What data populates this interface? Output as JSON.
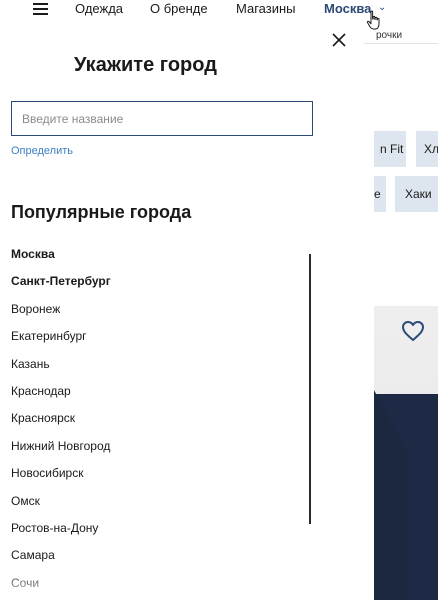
{
  "nav": {
    "items": [
      "Одежда",
      "О бренде",
      "Магазины"
    ],
    "city": "Москва"
  },
  "background": {
    "breadcrumb_fragment": "рочки",
    "chips": [
      "n Fit",
      "Хл",
      "е",
      "Хаки"
    ]
  },
  "modal": {
    "title": "Укажите город",
    "search_placeholder": "Введите название",
    "detect_label": "Определить",
    "popular_title": "Популярные города",
    "cities": [
      {
        "name": "Москва",
        "bold": true
      },
      {
        "name": "Санкт-Петербург",
        "bold": true
      },
      {
        "name": "Воронеж",
        "bold": false
      },
      {
        "name": "Екатеринбург",
        "bold": false
      },
      {
        "name": "Казань",
        "bold": false
      },
      {
        "name": "Краснодар",
        "bold": false
      },
      {
        "name": "Красноярск",
        "bold": false
      },
      {
        "name": "Нижний Новгород",
        "bold": false
      },
      {
        "name": "Новосибирск",
        "bold": false
      },
      {
        "name": "Омск",
        "bold": false
      },
      {
        "name": "Ростов-на-Дону",
        "bold": false
      },
      {
        "name": "Самара",
        "bold": false
      },
      {
        "name": "Сочи",
        "bold": false
      }
    ]
  },
  "icons": {
    "menu": "hamburger-menu-icon",
    "chevron": "chevron-down-icon",
    "close": "close-icon",
    "favorite": "heart-icon",
    "cursor": "hand-pointer-cursor-icon"
  },
  "colors": {
    "accent": "#2b4a78",
    "link": "#3d7fc4",
    "chip_bg": "#dde6ee",
    "text": "#1a1a1a"
  }
}
